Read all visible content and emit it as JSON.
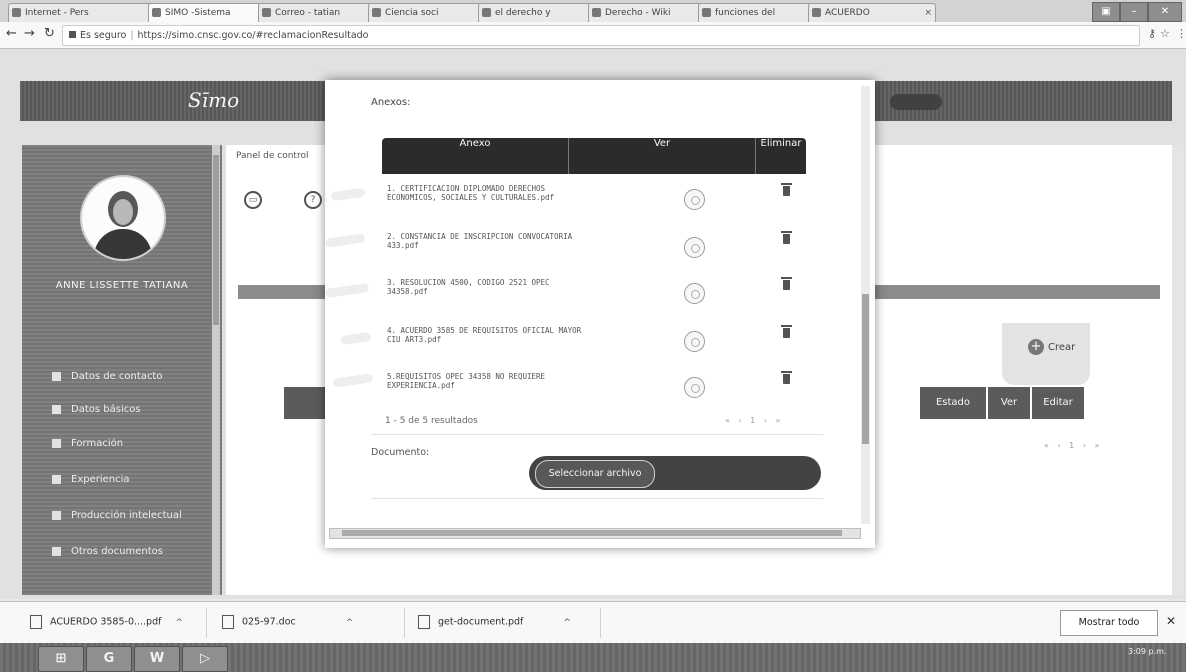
{
  "browser": {
    "tabs": [
      {
        "label": "Internet - Pers"
      },
      {
        "label": "SIMO -Sistema"
      },
      {
        "label": "Correo - tatian"
      },
      {
        "label": "Ciencia soci"
      },
      {
        "label": "el derecho y"
      },
      {
        "label": "Derecho - Wiki"
      },
      {
        "label": "funciones del"
      },
      {
        "label": "ACUERDO"
      }
    ],
    "secure_label": "Es seguro",
    "url": "https://simo.cnsc.gov.co/#reclamacionResultado"
  },
  "sidebar": {
    "username": "ANNE LISSETTE TATIANA",
    "items": [
      {
        "label": "Datos de contacto"
      },
      {
        "label": "Datos básicos"
      },
      {
        "label": "Formación"
      },
      {
        "label": "Experiencia"
      },
      {
        "label": "Producción intelectual"
      },
      {
        "label": "Otros documentos"
      }
    ]
  },
  "main": {
    "panel_label": "Panel de control",
    "crear_label": "Crear",
    "table_headers": [
      "Estado",
      "Ver",
      "Editar"
    ]
  },
  "modal": {
    "title": "Anexos:",
    "columns": {
      "anexo": "Anexo",
      "ver": "Ver",
      "eliminar": "Eliminar"
    },
    "rows": [
      {
        "name": "1. CERTIFICACION DIPLOMADO DERECHOS ECONOMICOS, SOCIALES Y CULTURALES.pdf"
      },
      {
        "name": "2. CONSTANCIA DE INSCRIPCION CONVOCATORIA 433.pdf"
      },
      {
        "name": "3. RESOLUCION 4500, CODIGO 2521 OPEC 34358.pdf"
      },
      {
        "name": "4. ACUERDO 3585 DE REQUISITOS OFICIAL MAYOR CIU ART3.pdf"
      },
      {
        "name": "5.REQUISITOS OPEC 34358 NO REQUIERE EXPERIENCIA.pdf"
      }
    ],
    "pager_text": "1 - 5 de 5 resultados",
    "pager_controls": "« ‹ 1 › »",
    "document_label": "Documento:",
    "select_button": "Seleccionar archivo"
  },
  "downloads": {
    "items": [
      {
        "name": "ACUERDO 3585-0....pdf"
      },
      {
        "name": "025-97.doc"
      },
      {
        "name": "get-document.pdf"
      }
    ],
    "show_all": "Mostrar todo"
  },
  "taskbar": {
    "clock": "3:09 p.m."
  },
  "colors": {
    "highlighter": "#f1f36a",
    "modal_header": "#2f2f2f"
  }
}
